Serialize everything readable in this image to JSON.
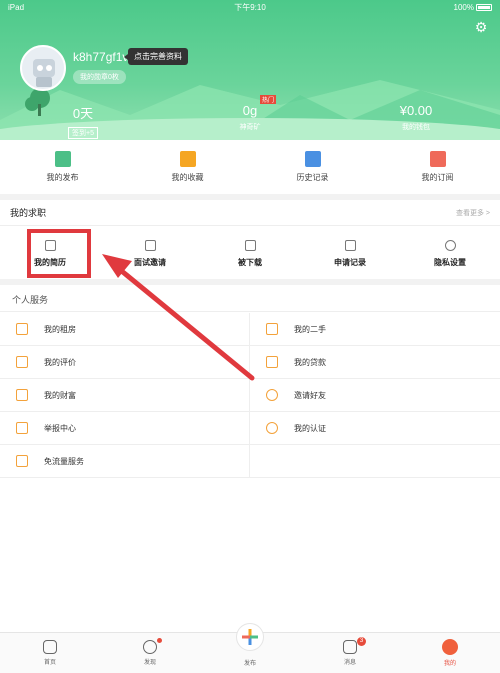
{
  "status_bar": {
    "device": "iPad",
    "time": "下午9:10",
    "battery": "100%"
  },
  "profile": {
    "username": "k8h77gf1v",
    "complete_tip": "点击完善资料",
    "badges_link": "我的勋章0枚",
    "stats": [
      {
        "value": "0天",
        "label": "签到+5"
      },
      {
        "value": "0g",
        "label": "神奇矿",
        "tag": "热门"
      },
      {
        "value": "¥0.00",
        "label": "我的钱包"
      }
    ]
  },
  "quick_actions": [
    {
      "label": "我的发布",
      "color": "#4cbf87"
    },
    {
      "label": "我的收藏",
      "color": "#f5a623"
    },
    {
      "label": "历史记录",
      "color": "#4a90e2"
    },
    {
      "label": "我的订阅",
      "color": "#ef6a5a"
    }
  ],
  "job_section": {
    "title": "我的求职",
    "more": "查看更多 >",
    "items": [
      "我的简历",
      "面试邀请",
      "被下载",
      "申请记录",
      "隐私设置"
    ]
  },
  "services": {
    "title": "个人服务",
    "rows": [
      [
        "我的租房",
        "我的二手"
      ],
      [
        "我的评价",
        "我的贷款"
      ],
      [
        "我的财富",
        "邀请好友"
      ],
      [
        "举报中心",
        "我的认证"
      ],
      [
        "免流量服务",
        ""
      ]
    ]
  },
  "tabbar": {
    "items": [
      "首页",
      "发现",
      "发布",
      "消息",
      "我的"
    ],
    "message_count": "3"
  }
}
